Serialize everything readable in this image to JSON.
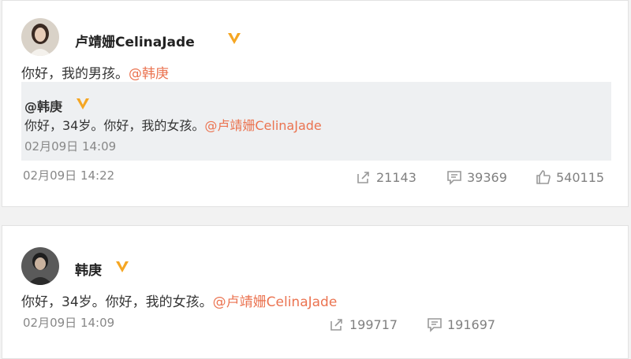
{
  "post1": {
    "author": "卢靖姗CelinaJade",
    "verified_icon": "verified-v-icon",
    "text": "你好，我的男孩。",
    "mention": "@韩庚",
    "time": "02月09日 14:22",
    "repost": {
      "author": "@韩庚",
      "text": "你好，34岁。你好，我的女孩。",
      "mention": "@卢靖姗CelinaJade",
      "time": "02月09日 14:09"
    },
    "actions": {
      "repost_count": "21143",
      "comment_count": "39369",
      "like_count": "540115"
    }
  },
  "post2": {
    "author": "韩庚",
    "verified_icon": "verified-v-icon",
    "text": "你好，34岁。你好，我的女孩。",
    "mention": "@卢靖姗CelinaJade",
    "time": "02月09日 14:09",
    "actions": {
      "repost_count": "199717",
      "comment_count": "191697"
    }
  },
  "colors": {
    "mention": "#eb7350",
    "verified": "#f5a623",
    "muted": "#888888"
  }
}
